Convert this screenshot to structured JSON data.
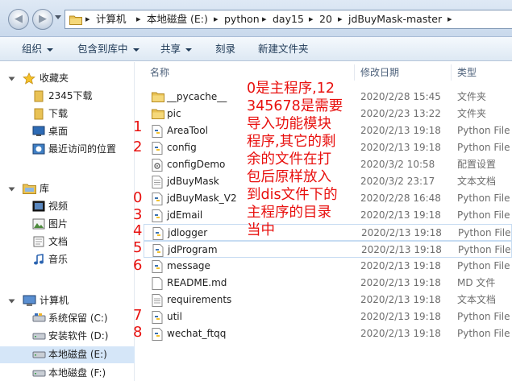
{
  "address": {
    "crumbs": [
      "计算机",
      "本地磁盘 (E:)",
      "python",
      "day15",
      "20",
      "jdBuyMask-master"
    ]
  },
  "toolbar": {
    "organize": "组织",
    "include_in_library": "包含到库中",
    "share": "共享",
    "burn": "刻录",
    "new_folder": "新建文件夹"
  },
  "nav": {
    "favorites": {
      "label": "收藏夹",
      "items": [
        "2345下载",
        "下载",
        "桌面",
        "最近访问的位置"
      ]
    },
    "library": {
      "label": "库",
      "items": [
        "视频",
        "图片",
        "文档",
        "音乐"
      ]
    },
    "computer": {
      "label": "计算机",
      "items": [
        "系统保留 (C:)",
        "安装软件 (D:)",
        "本地磁盘 (E:)",
        "本地磁盘 (F:)"
      ],
      "selected": "本地磁盘 (E:)"
    }
  },
  "columns": {
    "name": "名称",
    "date": "修改日期",
    "type": "类型"
  },
  "files": [
    {
      "name": "__pycache__",
      "date": "2020/2/28 15:45",
      "type": "文件夹",
      "icon": "folder"
    },
    {
      "name": "pic",
      "date": "2020/2/23 13:22",
      "type": "文件夹",
      "icon": "folder"
    },
    {
      "name": "AreaTool",
      "date": "2020/2/13 19:18",
      "type": "Python File",
      "icon": "python"
    },
    {
      "name": "config",
      "date": "2020/2/13 19:18",
      "type": "Python File",
      "icon": "python"
    },
    {
      "name": "configDemo",
      "date": "2020/3/2 10:58",
      "type": "配置设置",
      "icon": "config"
    },
    {
      "name": "jdBuyMask",
      "date": "2020/3/2 23:17",
      "type": "文本文档",
      "icon": "text"
    },
    {
      "name": "jdBuyMask_V2",
      "date": "2020/2/28 16:48",
      "type": "Python File",
      "icon": "python"
    },
    {
      "name": "jdEmail",
      "date": "2020/2/13 19:18",
      "type": "Python File",
      "icon": "python"
    },
    {
      "name": "jdlogger",
      "date": "2020/2/13 19:18",
      "type": "Python File",
      "icon": "python"
    },
    {
      "name": "jdProgram",
      "date": "2020/2/13 19:18",
      "type": "Python File",
      "icon": "python"
    },
    {
      "name": "message",
      "date": "2020/2/13 19:18",
      "type": "Python File",
      "icon": "python"
    },
    {
      "name": "README.md",
      "date": "2020/2/13 19:18",
      "type": "MD 文件",
      "icon": "blank"
    },
    {
      "name": "requirements",
      "date": "2020/2/13 19:18",
      "type": "文本文档",
      "icon": "text"
    },
    {
      "name": "util",
      "date": "2020/2/13 19:18",
      "type": "Python File",
      "icon": "python"
    },
    {
      "name": "wechat_ftqq",
      "date": "2020/2/13 19:18",
      "type": "Python File",
      "icon": "python"
    }
  ],
  "annotations": {
    "note": "0是主程序,12345678是需要导入功能模块程序,其它的剩余的文件在打包后原样放入到dis文件下的主程序的目录当中",
    "numbers": [
      "1",
      "2",
      "0",
      "3",
      "4",
      "5",
      "6",
      "7",
      "8"
    ],
    "color": "#e8100e"
  }
}
